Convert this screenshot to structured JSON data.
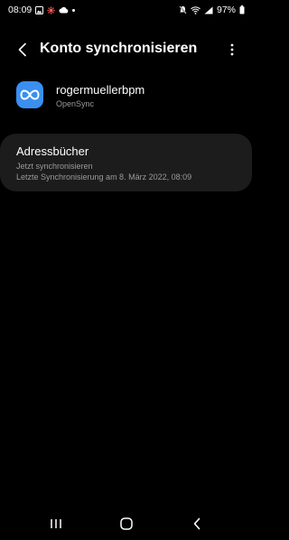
{
  "status_bar": {
    "time": "08:09",
    "battery": "97%",
    "icons": [
      "gallery-icon",
      "settings-icon",
      "cloud-icon",
      "dot-icon",
      "mute-icon",
      "wifi-icon",
      "signal-icon",
      "battery-icon"
    ]
  },
  "header": {
    "title": "Konto synchronisieren",
    "back_icon": "back-arrow-icon",
    "more_icon": "more-vertical-icon"
  },
  "account": {
    "name": "rogermuellerbpm",
    "type": "OpenSync",
    "icon": "infinity-icon",
    "icon_color": "#3a8ff0"
  },
  "sync_item": {
    "title": "Adressbücher",
    "status": "Jetzt synchronisieren",
    "last_sync": "Letzte Synchronisierung am 8. März 2022, 08:09"
  },
  "nav_bar": {
    "recents_icon": "recents-icon",
    "home_icon": "home-icon",
    "back_icon": "back-icon"
  }
}
